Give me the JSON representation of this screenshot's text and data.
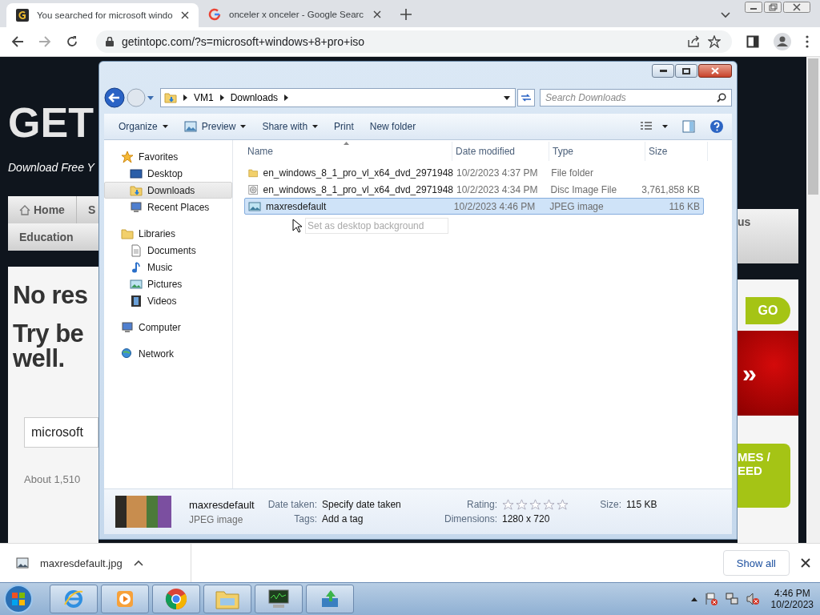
{
  "browser": {
    "tabs": [
      {
        "title": "You searched for microsoft windo",
        "kind": "site",
        "selected": true
      },
      {
        "title": "onceler x onceler - Google Searc",
        "kind": "google",
        "selected": false
      }
    ],
    "url": "getintopc.com/?s=microsoft+windows+8+pro+iso"
  },
  "website": {
    "logo": "GET",
    "tagline": "Download Free Y",
    "nav_row_1": [
      "Home",
      "S"
    ],
    "nav_row_2": [
      "Education"
    ],
    "nav_right": "us",
    "heading_1": "No res",
    "heading_2": "Try be\nwell.",
    "search_value": "microsoft",
    "result_count": "About 1,510",
    "go_button": "GO",
    "banner_arrow": "»",
    "promo": "MES /\nEED"
  },
  "explorer": {
    "breadcrumb": [
      "VM1",
      "Downloads"
    ],
    "search_placeholder": "Search Downloads",
    "toolbar": [
      {
        "label": "Organize",
        "menu": true,
        "icon": false
      },
      {
        "label": "Preview",
        "menu": true,
        "icon": true
      },
      {
        "label": "Share with",
        "menu": true,
        "icon": false
      },
      {
        "label": "Print",
        "menu": false,
        "icon": false
      },
      {
        "label": "New folder",
        "menu": false,
        "icon": false
      }
    ],
    "nav": [
      {
        "label": "Favorites",
        "kind": "favorites",
        "selected": false,
        "children": [
          {
            "label": "Desktop",
            "kind": "desktop",
            "selected": false
          },
          {
            "label": "Downloads",
            "kind": "downloads",
            "selected": true
          },
          {
            "label": "Recent Places",
            "kind": "recent",
            "selected": false
          }
        ]
      },
      {
        "label": "Libraries",
        "kind": "libraries",
        "selected": false,
        "children": [
          {
            "label": "Documents",
            "kind": "documents",
            "selected": false
          },
          {
            "label": "Music",
            "kind": "music",
            "selected": false
          },
          {
            "label": "Pictures",
            "kind": "pictures",
            "selected": false
          },
          {
            "label": "Videos",
            "kind": "videos",
            "selected": false
          }
        ]
      },
      {
        "label": "Computer",
        "kind": "computer",
        "selected": false
      },
      {
        "label": "Network",
        "kind": "network",
        "selected": false
      }
    ],
    "columns": [
      "Name",
      "Date modified",
      "Type",
      "Size"
    ],
    "files": [
      {
        "name": "en_windows_8_1_pro_vl_x64_dvd_2971948",
        "date": "10/2/2023 4:37 PM",
        "type": "File folder",
        "kind": "folder",
        "selected": false
      },
      {
        "name": "en_windows_8_1_pro_vl_x64_dvd_2971948",
        "date": "10/2/2023 4:34 PM",
        "type": "Disc Image File",
        "size": "3,761,858 KB",
        "kind": "disc",
        "selected": false
      },
      {
        "name": "maxresdefault",
        "date": "10/2/2023 4:46 PM",
        "type": "JPEG image",
        "size": "116 KB",
        "kind": "image",
        "selected": true
      }
    ],
    "drag_hint": "Set as desktop background",
    "details": {
      "name": "maxresdefault",
      "type": "JPEG image",
      "properties": [
        {
          "label": "Date taken:",
          "value": "Specify date taken",
          "kind": "text"
        },
        {
          "label": "Tags:",
          "value": "Add a tag",
          "kind": "text"
        },
        {
          "label": "Rating:",
          "stars": 0,
          "kind": "rating"
        },
        {
          "label": "Dimensions:",
          "value": "1280 x 720",
          "kind": "text"
        },
        {
          "label": "Size:",
          "value": "115 KB",
          "kind": "text"
        }
      ]
    }
  },
  "downloads_bar": {
    "file": "maxresdefault.jpg",
    "show_all": "Show all"
  },
  "taskbar": {
    "time": "4:46 PM",
    "date": "10/2/2023"
  }
}
